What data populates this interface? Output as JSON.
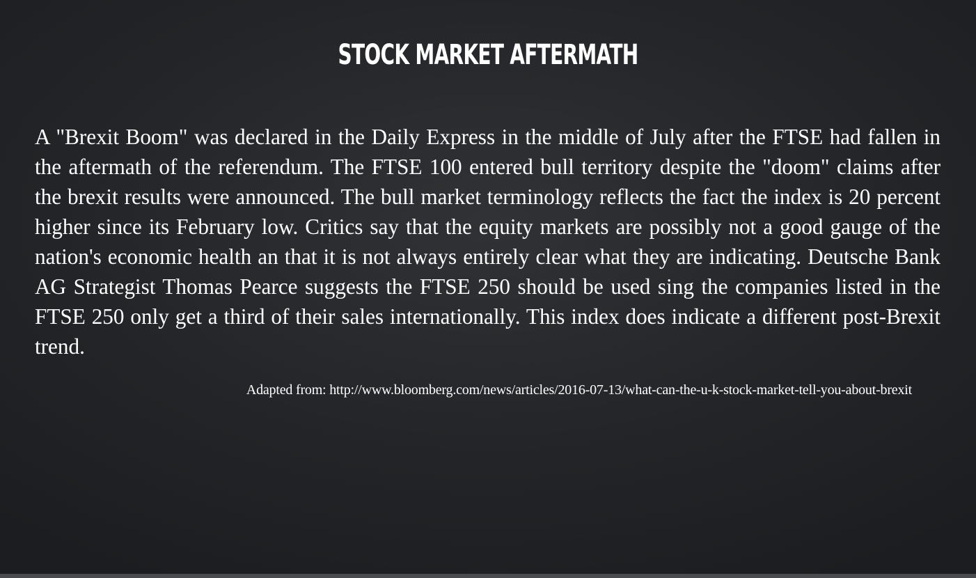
{
  "slide": {
    "title": "STOCK MARKET AFTERMATH",
    "body": "A \"Brexit Boom\" was declared in the Daily Express in the middle of July after the FTSE had fallen in the aftermath of the referendum. The FTSE 100 entered bull territory despite the \"doom\" claims after the brexit results were announced. The bull market terminology reflects the fact the index is 20 percent higher since its February low. Critics say that the equity markets are possibly not a good gauge of the nation's economic health an that it is not always entirely clear what they are indicating. Deutsche Bank AG Strategist Thomas Pearce suggests the FTSE 250 should be used sing the companies listed in the FTSE 250 only get a third of their sales internationally. This index does indicate a different post-Brexit trend.",
    "source": "Adapted from: http://www.bloomberg.com/news/articles/2016-07-13/what-can-the-u-k-stock-market-tell-you-about-brexit"
  },
  "colors": {
    "text": "#ffffff",
    "background_center": "#303235",
    "background_edge": "#1c1d20",
    "bottom_bar": "#4a4b4e"
  }
}
